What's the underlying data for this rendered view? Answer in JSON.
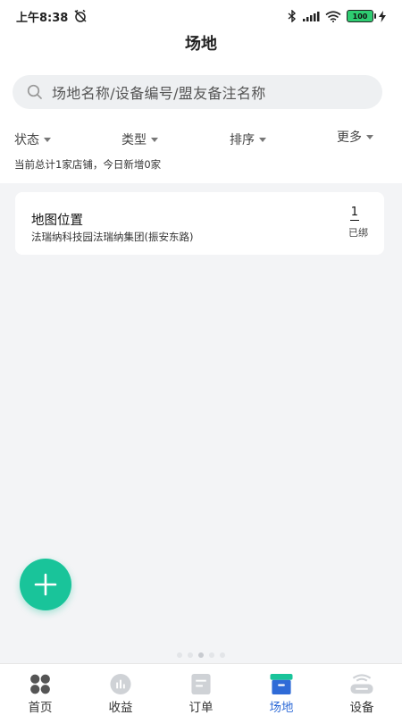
{
  "status_bar": {
    "time": "上午8:38",
    "battery": "100"
  },
  "header": {
    "title": "场地"
  },
  "search": {
    "placeholder": "场地名称/设备编号/盟友备注名称"
  },
  "filters": [
    {
      "label": "状态"
    },
    {
      "label": "类型"
    },
    {
      "label": "排序"
    },
    {
      "label": "更多"
    }
  ],
  "summary": "当前总计1家店铺，今日新增0家",
  "card": {
    "title": "地图位置",
    "address": "法瑞纳科技园法瑞纳集团(振安东路)",
    "count": "1",
    "count_label": "已绑"
  },
  "tabbar": {
    "items": [
      {
        "label": "首页",
        "icon": "grid-icon"
      },
      {
        "label": "收益",
        "icon": "chart-icon"
      },
      {
        "label": "订单",
        "icon": "document-icon"
      },
      {
        "label": "场地",
        "icon": "box-icon",
        "active": true
      },
      {
        "label": "设备",
        "icon": "router-icon"
      }
    ]
  },
  "colors": {
    "accent": "#19c49a",
    "tab_active": "#2f6bd7"
  }
}
